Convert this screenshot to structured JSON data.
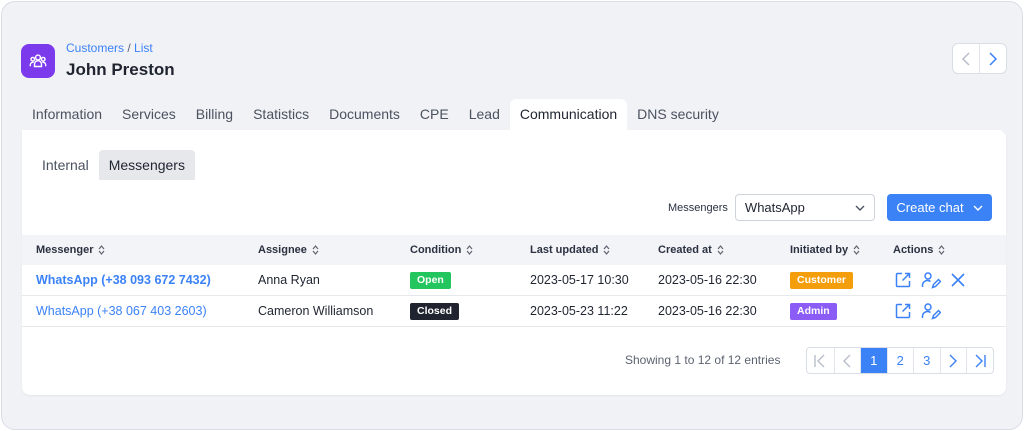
{
  "breadcrumb": {
    "parent": "Customers",
    "separator": "/",
    "current": "List"
  },
  "page_title": "John Preston",
  "tabs": [
    {
      "label": "Information"
    },
    {
      "label": "Services"
    },
    {
      "label": "Billing"
    },
    {
      "label": "Statistics"
    },
    {
      "label": "Documents"
    },
    {
      "label": "CPE"
    },
    {
      "label": "Lead"
    },
    {
      "label": "Communication",
      "active": true
    },
    {
      "label": "DNS security"
    }
  ],
  "subtabs": [
    {
      "label": "Internal"
    },
    {
      "label": "Messengers",
      "active": true
    }
  ],
  "filter": {
    "label": "Messengers",
    "value": "WhatsApp"
  },
  "create_button": {
    "label": "Create chat"
  },
  "table": {
    "columns": [
      "Messenger",
      "Assignee",
      "Condition",
      "Last updated",
      "Created at",
      "Initiated by",
      "Actions"
    ],
    "rows": [
      {
        "messenger": "WhatsApp (+38 093 672 7432)",
        "assignee": "Anna Ryan",
        "condition": "Open",
        "last_updated": "2023-05-17 10:30",
        "created_at": "2023-05-16 22:30",
        "initiated_by": "Customer"
      },
      {
        "messenger": "WhatsApp (+38 067 403 2603)",
        "assignee": "Cameron Williamson",
        "condition": "Closed",
        "last_updated": "2023-05-23 11:22",
        "created_at": "2023-05-16 22:30",
        "initiated_by": "Admin"
      }
    ]
  },
  "footer": {
    "showing": "Showing 1 to 12 of 12 entries",
    "pages": [
      "1",
      "2",
      "3"
    ]
  },
  "colors": {
    "accent": "#3b82f6",
    "app_icon": "#7c3aed",
    "open": "#22c55e",
    "closed": "#1f2430",
    "customer": "#f59e0b",
    "admin": "#8b5cf6"
  }
}
